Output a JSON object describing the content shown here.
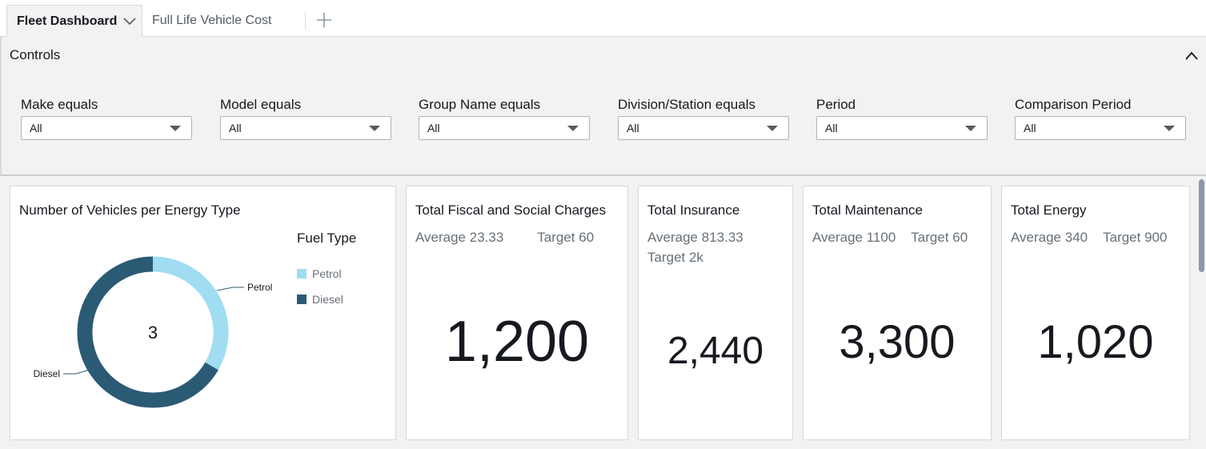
{
  "tabs": [
    {
      "label": "Fleet Dashboard",
      "active": true
    },
    {
      "label": "Full Life Vehicle Cost",
      "active": false
    }
  ],
  "controls": {
    "title": "Controls",
    "filters": [
      {
        "label": "Make equals",
        "value": "All"
      },
      {
        "label": "Model equals",
        "value": "All"
      },
      {
        "label": "Group Name equals",
        "value": "All"
      },
      {
        "label": "Division/Station equals",
        "value": "All"
      },
      {
        "label": "Period",
        "value": "All"
      },
      {
        "label": "Comparison Period",
        "value": "All"
      }
    ]
  },
  "donut": {
    "title": "Number of Vehicles per Energy Type",
    "center_value": "3",
    "legend_title": "Fuel Type",
    "colors": {
      "Petrol": "#a0dcf2",
      "Diesel": "#2b5a75"
    },
    "chart_data": {
      "type": "pie",
      "categories": [
        "Petrol",
        "Diesel"
      ],
      "values": [
        1,
        2
      ],
      "title": "Number of Vehicles per Energy Type",
      "legend": "right"
    }
  },
  "kpis": {
    "fiscal": {
      "title": "Total Fiscal and Social Charges",
      "average": "Average 23.33",
      "target": "Target 60",
      "value": "1,200"
    },
    "insurance": {
      "title": "Total Insurance",
      "average": "Average 813.33",
      "target": "Target 2k",
      "value": "2,440"
    },
    "maintenance": {
      "title": "Total Maintenance",
      "average": "Average 1100",
      "target": "Target 60",
      "value": "3,300"
    },
    "energy": {
      "title": "Total Energy",
      "average": "Average 340",
      "target": "Target 900",
      "value": "1,020"
    }
  }
}
